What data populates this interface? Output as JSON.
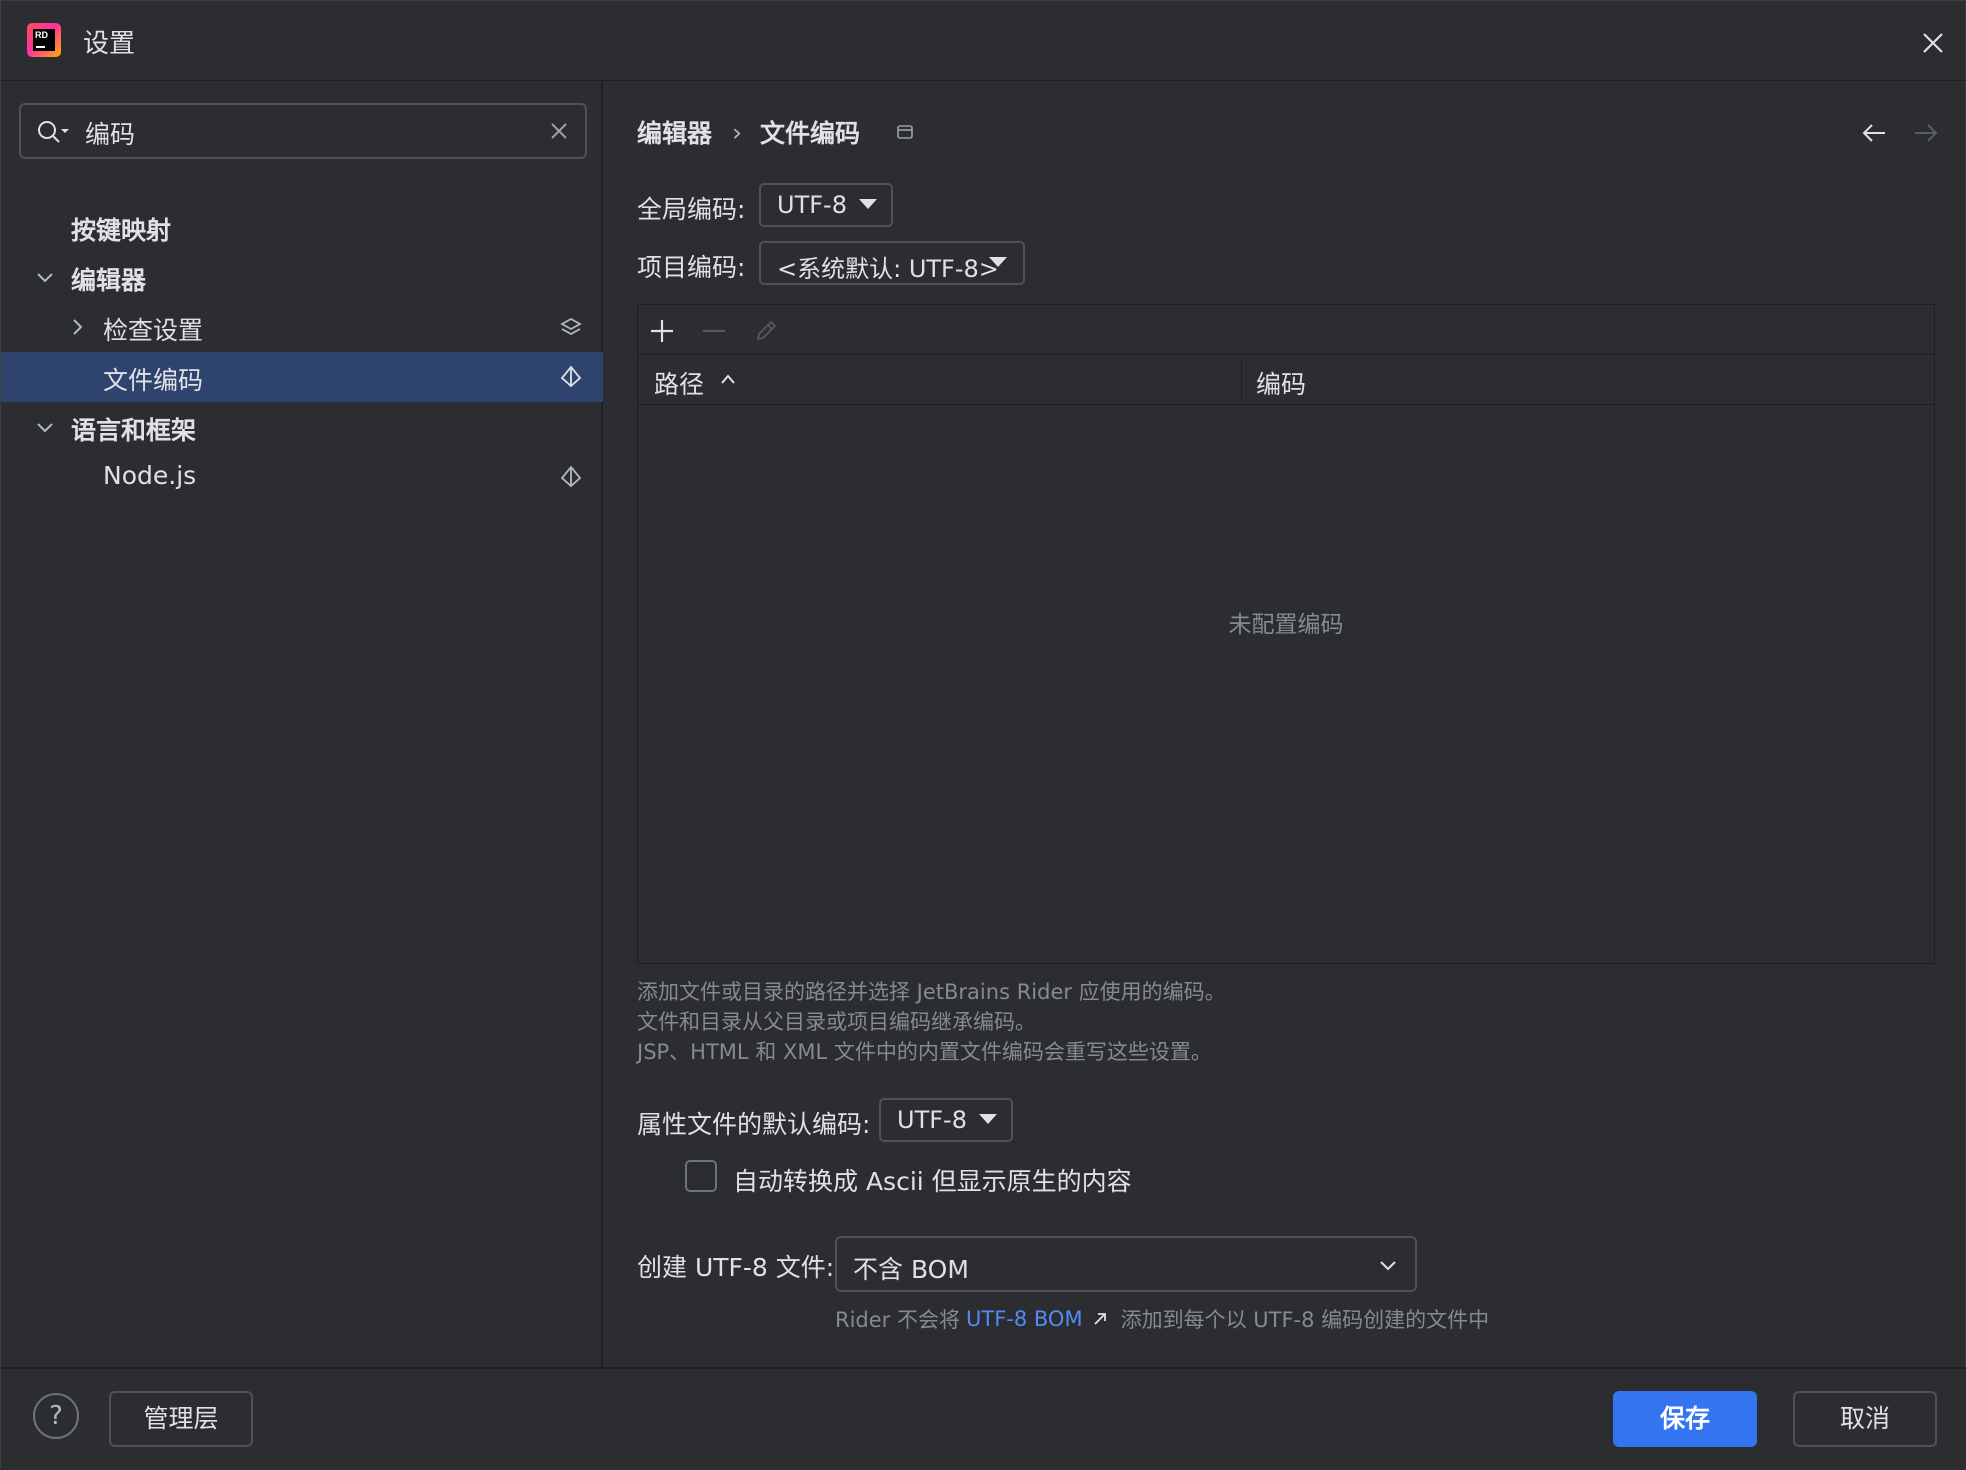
{
  "window": {
    "title": "设置"
  },
  "search": {
    "value": "编码"
  },
  "tree": {
    "items": [
      {
        "label": "按键映射"
      },
      {
        "label": "编辑器"
      },
      {
        "label": "检查设置"
      },
      {
        "label": "文件编码"
      },
      {
        "label": "语言和框架"
      },
      {
        "label": "Node.js"
      }
    ]
  },
  "breadcrumb": {
    "parent": "编辑器",
    "separator": "›",
    "current": "文件编码"
  },
  "global_encoding": {
    "label": "全局编码:",
    "value": "UTF-8"
  },
  "project_encoding": {
    "label": "项目编码:",
    "value": "<系统默认: UTF-8>"
  },
  "table": {
    "columns": [
      "路径",
      "编码"
    ],
    "empty_text": "未配置编码"
  },
  "hints": [
    "添加文件或目录的路径并选择 JetBrains Rider 应使用的编码。",
    "文件和目录从父目录或项目编码继承编码。",
    "JSP、HTML 和 XML 文件中的内置文件编码会重写这些设置。"
  ],
  "properties_encoding": {
    "label": "属性文件的默认编码:",
    "value": "UTF-8"
  },
  "auto_ascii": {
    "label": "自动转换成 Ascii 但显示原生的内容",
    "checked": false
  },
  "bom": {
    "label": "创建 UTF-8 文件:",
    "value": "不含 BOM",
    "hint_prefix": "Rider 不会将",
    "hint_link": "UTF-8 BOM",
    "hint_suffix": "添加到每个以 UTF-8 编码创建的文件中"
  },
  "footer": {
    "help_label": "?",
    "manage_label": "管理层",
    "save_label": "保存",
    "cancel_label": "取消"
  },
  "colors": {
    "background": "#2b2d30",
    "selection": "#2e436e",
    "accent": "#3574f0",
    "link": "#548af7",
    "muted_text": "#868a91"
  }
}
